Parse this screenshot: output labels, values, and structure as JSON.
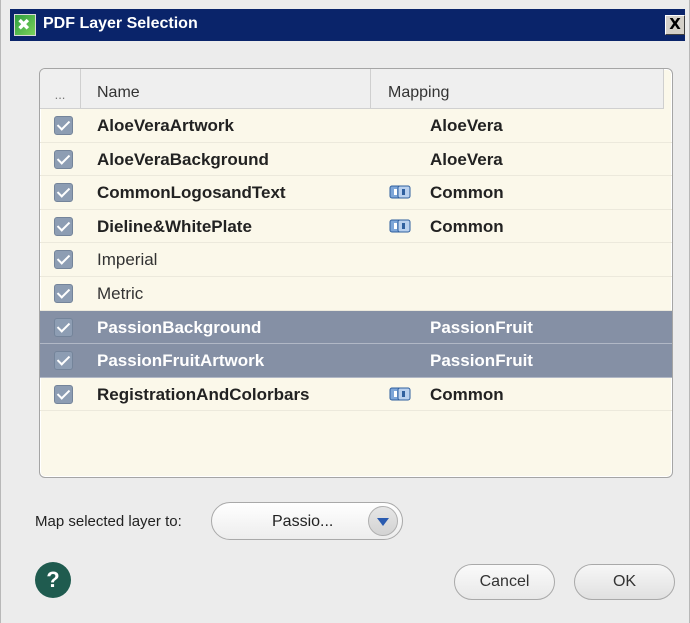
{
  "window": {
    "title": "PDF Layer Selection",
    "close_label": "X"
  },
  "table": {
    "columns": [
      "...",
      "Name",
      "Mapping"
    ],
    "rows": [
      {
        "name": "AloeVeraArtwork",
        "mapping": "AloeVera",
        "bold": true,
        "linked": false,
        "selected": false
      },
      {
        "name": "AloeVeraBackground",
        "mapping": "AloeVera",
        "bold": true,
        "linked": false,
        "selected": false
      },
      {
        "name": "CommonLogosandText",
        "mapping": "Common",
        "bold": true,
        "linked": true,
        "selected": false
      },
      {
        "name": "Dieline&WhitePlate",
        "mapping": "Common",
        "bold": true,
        "linked": true,
        "selected": false
      },
      {
        "name": "Imperial",
        "mapping": "",
        "bold": false,
        "linked": false,
        "selected": false
      },
      {
        "name": "Metric",
        "mapping": "",
        "bold": false,
        "linked": false,
        "selected": false
      },
      {
        "name": "PassionBackground",
        "mapping": "PassionFruit",
        "bold": true,
        "linked": false,
        "selected": true
      },
      {
        "name": "PassionFruitArtwork",
        "mapping": "PassionFruit",
        "bold": true,
        "linked": false,
        "selected": true
      },
      {
        "name": "RegistrationAndColorbars",
        "mapping": "Common",
        "bold": true,
        "linked": true,
        "selected": false
      }
    ]
  },
  "footer": {
    "map_label": "Map selected layer to:",
    "dropdown_value": "Passio...",
    "help_label": "?",
    "cancel_label": "Cancel",
    "ok_label": "OK"
  },
  "colors": {
    "title_bar": "#0a246a",
    "selected_row": "#8590a5",
    "list_background": "#fbf8ea",
    "help_button": "#1f5b4f"
  }
}
